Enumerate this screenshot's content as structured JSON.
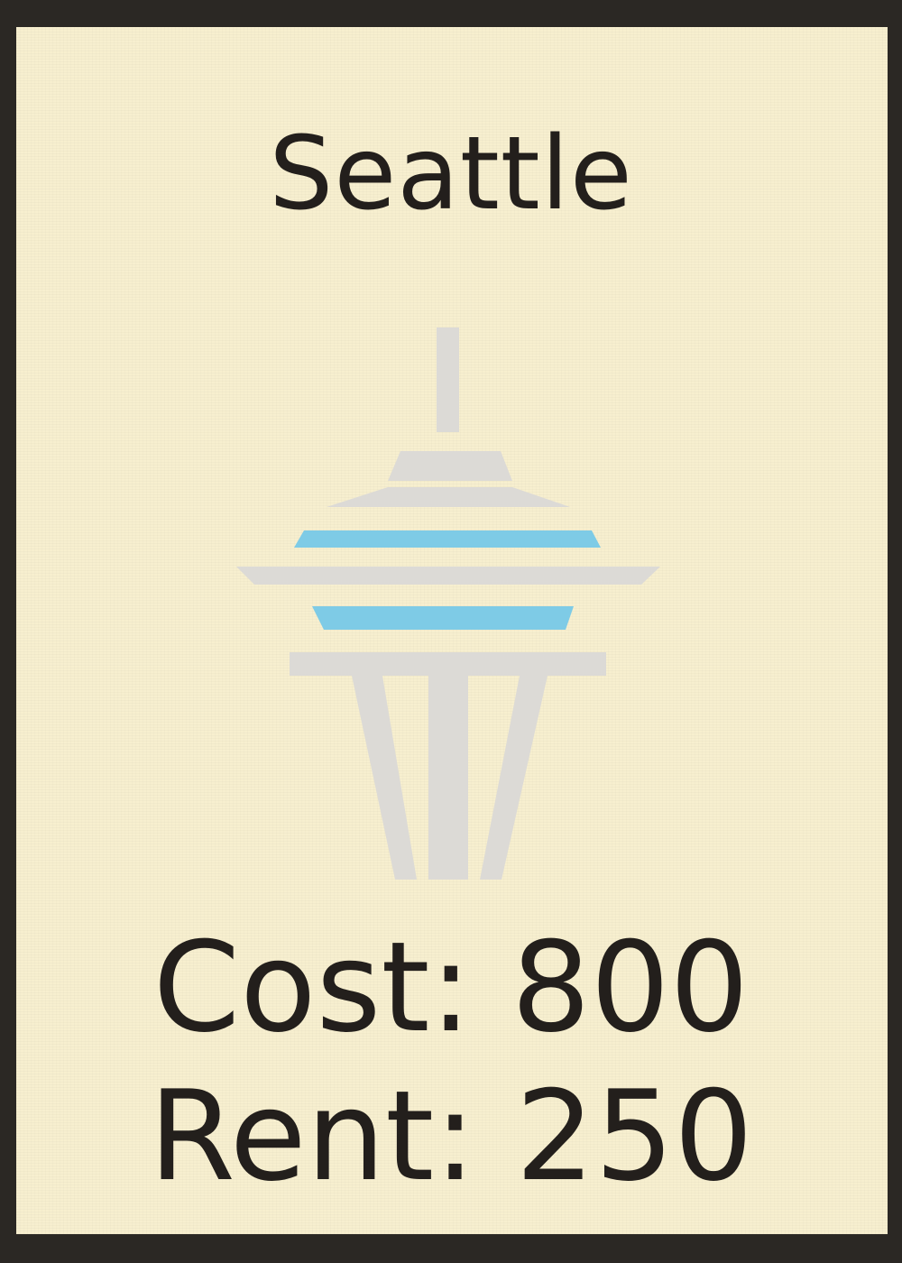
{
  "card": {
    "title": "Seattle",
    "cost_label": "Cost: 800",
    "rent_label": "Rent: 250",
    "landmark_icon": "space-needle-icon",
    "colors": {
      "frame": "#2b2824",
      "card_background": "#f7efcf",
      "text": "#231f1c",
      "tower_gray": "#dcdad6",
      "tower_blue": "#7ecbe6"
    }
  }
}
